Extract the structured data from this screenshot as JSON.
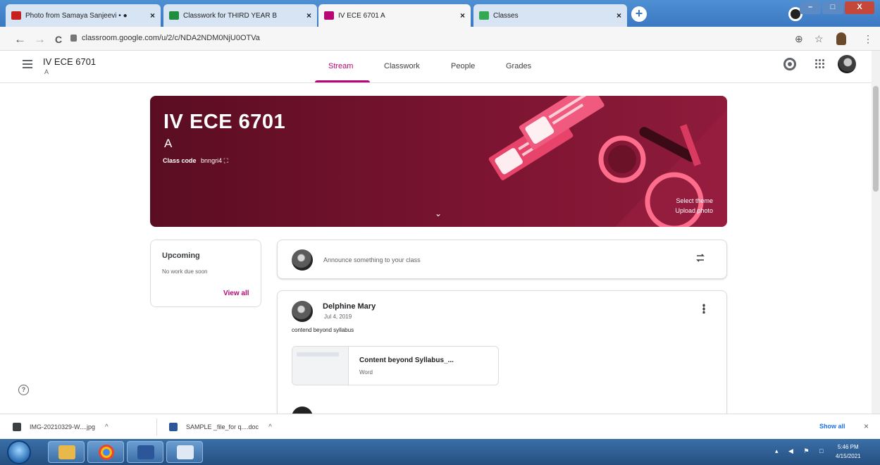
{
  "browser": {
    "tabs": [
      {
        "title": "Photo from Samaya Sanjeevi • ●",
        "close": "×",
        "favicon_color": "#c5221f"
      },
      {
        "title": "Classwork for THIRD YEAR B",
        "close": "×",
        "favicon_color": "#1e8e3e"
      },
      {
        "title": "IV ECE 6701 A",
        "close": "×",
        "favicon_color": "#b80672"
      },
      {
        "title": "Classes",
        "close": "×",
        "favicon_color": "#34a853"
      }
    ],
    "new_tab": "+",
    "window_buttons": [
      "–",
      "□",
      "X"
    ],
    "url": "classroom.google.com/u/2/c/NDA2NDM0NjU0OTVa",
    "nav": {
      "back": "←",
      "forward": "→",
      "reload": "C"
    },
    "addr_icons": {
      "zoom": "⊕",
      "star": "☆",
      "menu": "⋮"
    }
  },
  "classroom": {
    "course_title": "IV ECE 6701",
    "course_section": "A",
    "tabs": [
      "Stream",
      "Classwork",
      "People",
      "Grades"
    ],
    "active_tab": "Stream",
    "accent": "#b80672"
  },
  "banner": {
    "title": "IV ECE 6701",
    "section": "A",
    "class_code_label": "Class code",
    "class_code": "bnngri4 ⛶",
    "expand": "⌄",
    "select_theme": "Select theme",
    "upload_photo": "Upload photo"
  },
  "upcoming": {
    "title": "Upcoming",
    "empty_text": "No work due soon",
    "view_all": "View all"
  },
  "announce": {
    "placeholder": "Announce something to your class"
  },
  "post": {
    "author": "Delphine Mary",
    "date": "Jul 4, 2019",
    "body": "contend beyond syllabus",
    "attachment_title": "Content beyond Syllabus_...",
    "attachment_type": "Word"
  },
  "help": "?",
  "downloads": {
    "items": [
      {
        "name": "IMG-20210329-W....jpg",
        "caret": "^",
        "icon_color": "#3c4043"
      },
      {
        "name": "SAMPLE _file_for q....doc",
        "caret": "^",
        "icon_color": "#2b579a"
      }
    ],
    "show_all": "Show all",
    "close": "×"
  },
  "taskbar": {
    "clock_time": "5:46 PM",
    "clock_date": "4/15/2021",
    "tray": "▴ ◀ ⚑ □"
  }
}
